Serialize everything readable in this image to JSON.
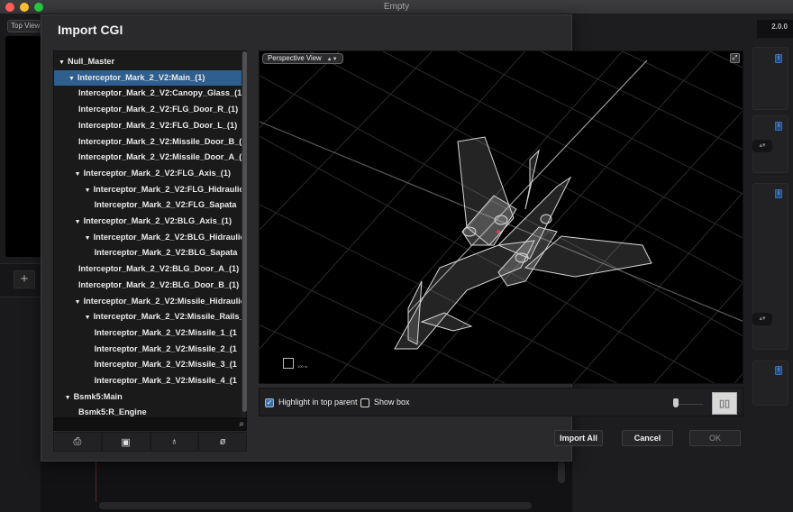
{
  "window": {
    "title": "Empty"
  },
  "background_app": {
    "top_view_label": "Top View",
    "version": "2.0.0",
    "add_label": "+",
    "info_label": "i"
  },
  "dialog": {
    "title": "Import CGI",
    "tree": [
      {
        "label": "Null_Master",
        "level": 0,
        "expanded": true,
        "selected": false
      },
      {
        "label": "Interceptor_Mark_2_V2:Main_(1)",
        "level": 1,
        "expanded": true,
        "selected": true
      },
      {
        "label": "Interceptor_Mark_2_V2:Canopy_Glass_(1",
        "level": 2,
        "expanded": null,
        "selected": false
      },
      {
        "label": "Interceptor_Mark_2_V2:FLG_Door_R_(1)",
        "level": 2,
        "expanded": null,
        "selected": false
      },
      {
        "label": "Interceptor_Mark_2_V2:FLG_Door_L_(1)",
        "level": 2,
        "expanded": null,
        "selected": false
      },
      {
        "label": "Interceptor_Mark_2_V2:Missile_Door_B_(",
        "level": 2,
        "expanded": null,
        "selected": false
      },
      {
        "label": "Interceptor_Mark_2_V2:Missile_Door_A_(",
        "level": 2,
        "expanded": null,
        "selected": false
      },
      {
        "label": "Interceptor_Mark_2_V2:FLG_Axis_(1)",
        "level": 1.6,
        "expanded": true,
        "selected": false
      },
      {
        "label": "Interceptor_Mark_2_V2:FLG_Hidraulic_",
        "level": 2.6,
        "expanded": true,
        "selected": false
      },
      {
        "label": "Interceptor_Mark_2_V2:FLG_Sapata",
        "level": 3.6,
        "expanded": null,
        "selected": false
      },
      {
        "label": "Interceptor_Mark_2_V2:BLG_Axis_(1)",
        "level": 1.6,
        "expanded": true,
        "selected": false
      },
      {
        "label": "Interceptor_Mark_2_V2:BLG_Hidraulic",
        "level": 2.6,
        "expanded": true,
        "selected": false
      },
      {
        "label": "Interceptor_Mark_2_V2:BLG_Sapata",
        "level": 3.6,
        "expanded": null,
        "selected": false
      },
      {
        "label": "Interceptor_Mark_2_V2:BLG_Door_A_(1)",
        "level": 2,
        "expanded": null,
        "selected": false
      },
      {
        "label": "Interceptor_Mark_2_V2:BLG_Door_B_(1)",
        "level": 2,
        "expanded": null,
        "selected": false
      },
      {
        "label": "Interceptor_Mark_2_V2:Missile_Hidraulics",
        "level": 1.6,
        "expanded": true,
        "selected": false
      },
      {
        "label": "Interceptor_Mark_2_V2:Missile_Rails_(",
        "level": 2.6,
        "expanded": true,
        "selected": false
      },
      {
        "label": "Interceptor_Mark_2_V2:Missile_1_(1",
        "level": 3.6,
        "expanded": null,
        "selected": false
      },
      {
        "label": "Interceptor_Mark_2_V2:Missile_2_(1",
        "level": 3.6,
        "expanded": null,
        "selected": false
      },
      {
        "label": "Interceptor_Mark_2_V2:Missile_3_(1",
        "level": 3.6,
        "expanded": null,
        "selected": false
      },
      {
        "label": "Interceptor_Mark_2_V2:Missile_4_(1",
        "level": 3.6,
        "expanded": null,
        "selected": false
      },
      {
        "label": "Bsmk5:Main",
        "level": 0.6,
        "expanded": true,
        "selected": false
      },
      {
        "label": "Bsmk5:R_Engine",
        "level": 2,
        "expanded": null,
        "selected": false
      }
    ],
    "search_icon": "magnifier-icon",
    "tool_buttons": [
      {
        "name": "camera-icon",
        "glyph": "⎙"
      },
      {
        "name": "cube-icon",
        "glyph": "▣"
      },
      {
        "name": "light-icon",
        "glyph": "♁"
      },
      {
        "name": "null-icon",
        "glyph": "ø"
      }
    ],
    "viewport": {
      "view_mode": "Perspective View",
      "expand_icon": "expand-icon",
      "scale_label": "100 m"
    },
    "options": {
      "highlight_label": "Highlight in top parent",
      "highlight_checked": true,
      "show_box_label": "Show box",
      "show_box_checked": false,
      "slider_value": 0
    },
    "buttons": {
      "import_all": "Import All",
      "cancel": "Cancel",
      "ok": "OK"
    }
  },
  "colors": {
    "selection": "#2f5f8f",
    "checkbox": "#3d6fa6",
    "info_badge": "#1f4c8a"
  }
}
